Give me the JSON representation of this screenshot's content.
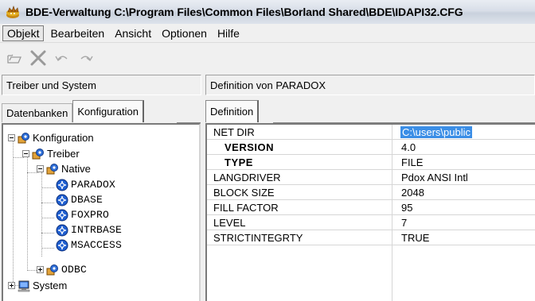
{
  "window": {
    "title": "BDE-Verwaltung  C:\\Program Files\\Common Files\\Borland Shared\\BDE\\IDAPI32.CFG"
  },
  "menu": [
    {
      "label": "Objekt"
    },
    {
      "label": "Bearbeiten"
    },
    {
      "label": "Ansicht"
    },
    {
      "label": "Optionen"
    },
    {
      "label": "Hilfe"
    }
  ],
  "toolbar": {
    "icons": [
      "open-icon",
      "delete-icon",
      "undo-icon",
      "redo-icon"
    ]
  },
  "left_pane": {
    "header": "Treiber und System",
    "tabs": [
      "Datenbanken",
      "Konfiguration"
    ],
    "selected_tab": "Konfiguration",
    "tree": {
      "root": "Konfiguration",
      "treiber": "Treiber",
      "native": "Native",
      "drivers": [
        "PARADOX",
        "DBASE",
        "FOXPRO",
        "INTRBASE",
        "MSACCESS"
      ],
      "odbc": "ODBC",
      "system": "System"
    }
  },
  "right_pane": {
    "header": "Definition von PARADOX",
    "tab": "Definition",
    "properties": [
      {
        "name": "NET DIR",
        "value": "C:\\users\\public",
        "bold": false,
        "selected": true
      },
      {
        "name": "VERSION",
        "value": "4.0",
        "bold": true
      },
      {
        "name": "TYPE",
        "value": "FILE",
        "bold": true
      },
      {
        "name": "LANGDRIVER",
        "value": "Pdox ANSI Intl",
        "bold": false
      },
      {
        "name": "BLOCK SIZE",
        "value": "2048",
        "bold": false
      },
      {
        "name": "FILL FACTOR",
        "value": "95",
        "bold": false
      },
      {
        "name": "LEVEL",
        "value": "7",
        "bold": false
      },
      {
        "name": "STRICTINTEGRTY",
        "value": "TRUE",
        "bold": false
      }
    ]
  },
  "colors": {
    "selection": "#3b8ee6",
    "driver_icon": "#1f5fd1"
  }
}
